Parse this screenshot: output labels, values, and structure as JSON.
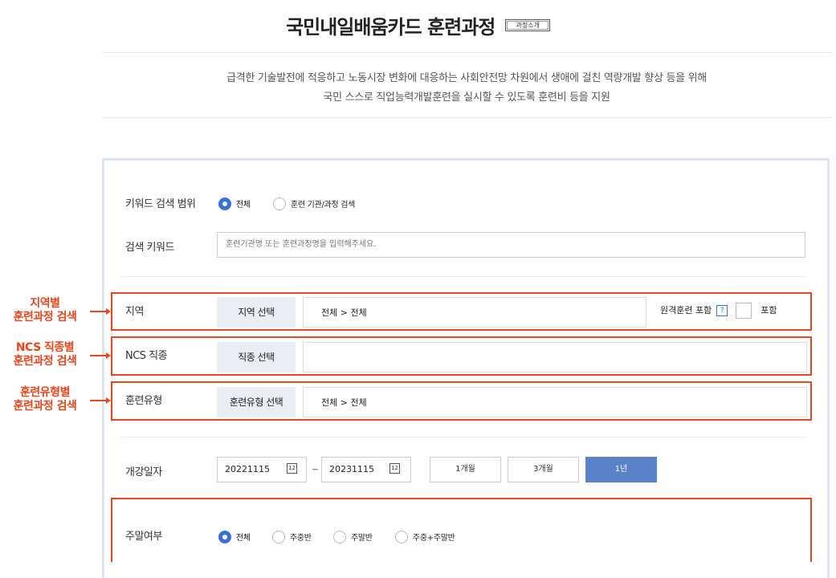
{
  "header": {
    "title": "국민내일배움카드 훈련과정",
    "intro_button": "과정소개",
    "description_line1": "급격한 기술발전에 적응하고 노동시장 변화에 대응하는 사회안전망 차원에서 생애에 걸친 역량개발 향상 등을 위해",
    "description_line2": "국민 스스로 직업능력개발훈련을 실시할 수 있도록 훈련비 등을 지원"
  },
  "search": {
    "scope_label": "키워드 검색 범위",
    "scope_options": [
      "전체",
      "훈련 기관/과정 검색"
    ],
    "scope_selected": "전체",
    "keyword_label": "검색 키워드",
    "keyword_placeholder": "훈련기관명 또는 훈련과정명을 입력해주세요.",
    "region": {
      "label": "지역",
      "button": "지역 선택",
      "value": "전체 > 전체",
      "remote_label": "원격훈련 포함",
      "help_icon": "?",
      "include_label": "포함"
    },
    "ncs": {
      "label": "NCS 직종",
      "button": "직종 선택",
      "value": ""
    },
    "type": {
      "label": "훈련유형",
      "button": "훈련유형 선택",
      "value": "전체 > 전체"
    },
    "date": {
      "label": "개강일자",
      "start": "20221115",
      "end": "20231115",
      "separator": "~",
      "calendar_icon_text": "12",
      "periods": [
        "1개월",
        "3개월",
        "1년"
      ],
      "period_selected": "1년"
    },
    "weekend": {
      "label": "주말여부",
      "options": [
        "전체",
        "주중반",
        "주말반",
        "주중+주말반"
      ],
      "selected": "전체"
    }
  },
  "annotations": {
    "region_line1": "지역별",
    "region_line2": "훈련과정 검색",
    "ncs_line1": "NCS 직종별",
    "ncs_line2": "훈련과정 검색",
    "type_line1": "훈련유형별",
    "type_line2": "훈련과정 검색"
  },
  "colors": {
    "accent": "#3b6fd8",
    "annotation": "#e8461e",
    "selected_period": "#5b81c8",
    "select_button_bg": "#e9eef6"
  }
}
